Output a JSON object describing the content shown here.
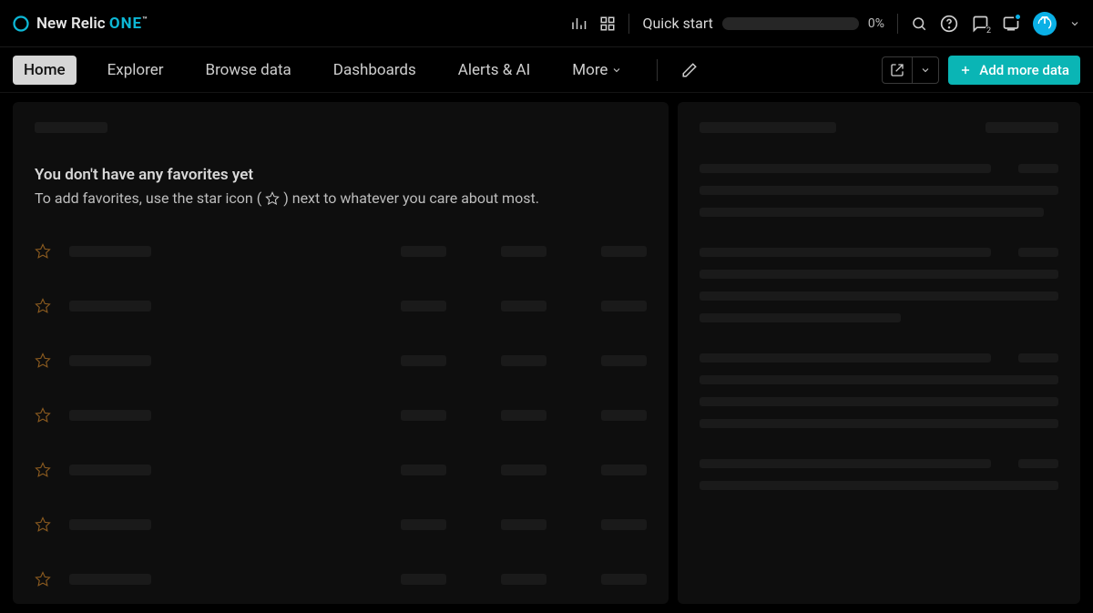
{
  "header": {
    "brand_a": "New Relic",
    "brand_b": "ONE",
    "brand_tm": "™",
    "quick_start": "Quick start",
    "progress_pct": "0%"
  },
  "nav": {
    "items": [
      {
        "label": "Home",
        "active": true
      },
      {
        "label": "Explorer",
        "active": false
      },
      {
        "label": "Browse data",
        "active": false
      },
      {
        "label": "Dashboards",
        "active": false
      },
      {
        "label": "Alerts & AI",
        "active": false
      }
    ],
    "more_label": "More",
    "add_data_label": "Add more data"
  },
  "favorites": {
    "title": "You don't have any favorites yet",
    "sub_a": "To add favorites, use the star icon (",
    "sub_b": ") next to whatever you care about most."
  },
  "icons": {
    "chart": "chart-icon",
    "apps": "apps-icon",
    "search": "search-icon",
    "help": "help-icon",
    "feedback": "feedback-icon",
    "feed": "feed-icon",
    "pencil": "pencil-icon",
    "share": "share-icon",
    "chevron_down": "chevron-down-icon",
    "plus": "plus-icon",
    "star": "star-icon",
    "power": "power-icon"
  }
}
